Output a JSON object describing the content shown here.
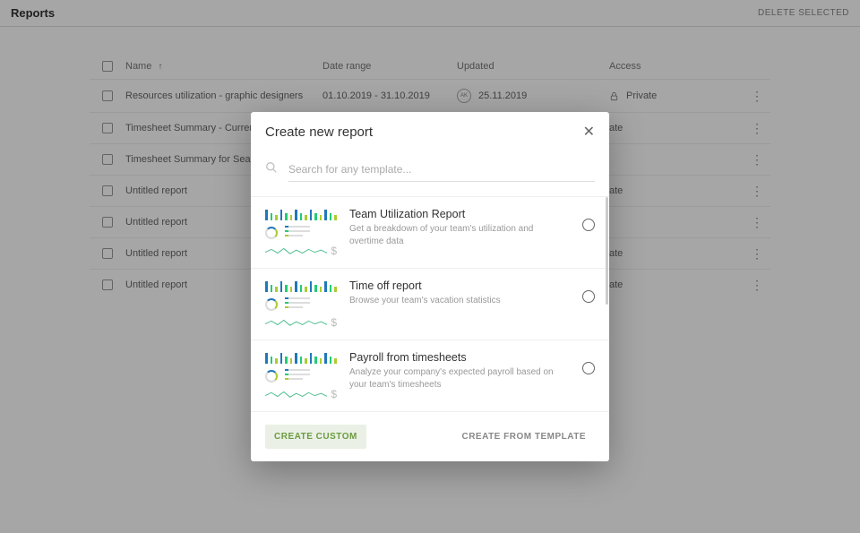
{
  "header": {
    "title": "Reports",
    "delete_label": "DELETE SELECTED"
  },
  "table": {
    "columns": {
      "name": "Name",
      "range": "Date range",
      "updated": "Updated",
      "access": "Access"
    },
    "rows": [
      {
        "name": "Resources utilization - graphic designers",
        "range": "01.10.2019 - 31.10.2019",
        "updated": "25.11.2019",
        "avatar": "AK",
        "access": "Private"
      },
      {
        "name": "Timesheet Summary - Current Month",
        "range": "",
        "updated": "",
        "avatar": "",
        "access": "ate"
      },
      {
        "name": "Timesheet Summary for Sea Hotels b",
        "range": "",
        "updated": "",
        "avatar": "",
        "access": ""
      },
      {
        "name": "Untitled report",
        "range": "",
        "updated": "",
        "avatar": "",
        "access": "ate"
      },
      {
        "name": "Untitled report",
        "range": "",
        "updated": "",
        "avatar": "",
        "access": ""
      },
      {
        "name": "Untitled report",
        "range": "",
        "updated": "",
        "avatar": "",
        "access": "ate"
      },
      {
        "name": "Untitled report",
        "range": "",
        "updated": "",
        "avatar": "",
        "access": "ate"
      }
    ]
  },
  "modal": {
    "title": "Create new report",
    "search_placeholder": "Search for any template...",
    "templates": [
      {
        "title": "Team Utilization Report",
        "desc": "Get a breakdown of your team's utilization and overtime data"
      },
      {
        "title": "Time off report",
        "desc": "Browse your team's vacation statistics"
      },
      {
        "title": "Payroll from timesheets",
        "desc": "Analyze your company's expected payroll based on your team's timesheets"
      }
    ],
    "footer": {
      "custom": "CREATE CUSTOM",
      "template": "CREATE FROM TEMPLATE"
    }
  }
}
